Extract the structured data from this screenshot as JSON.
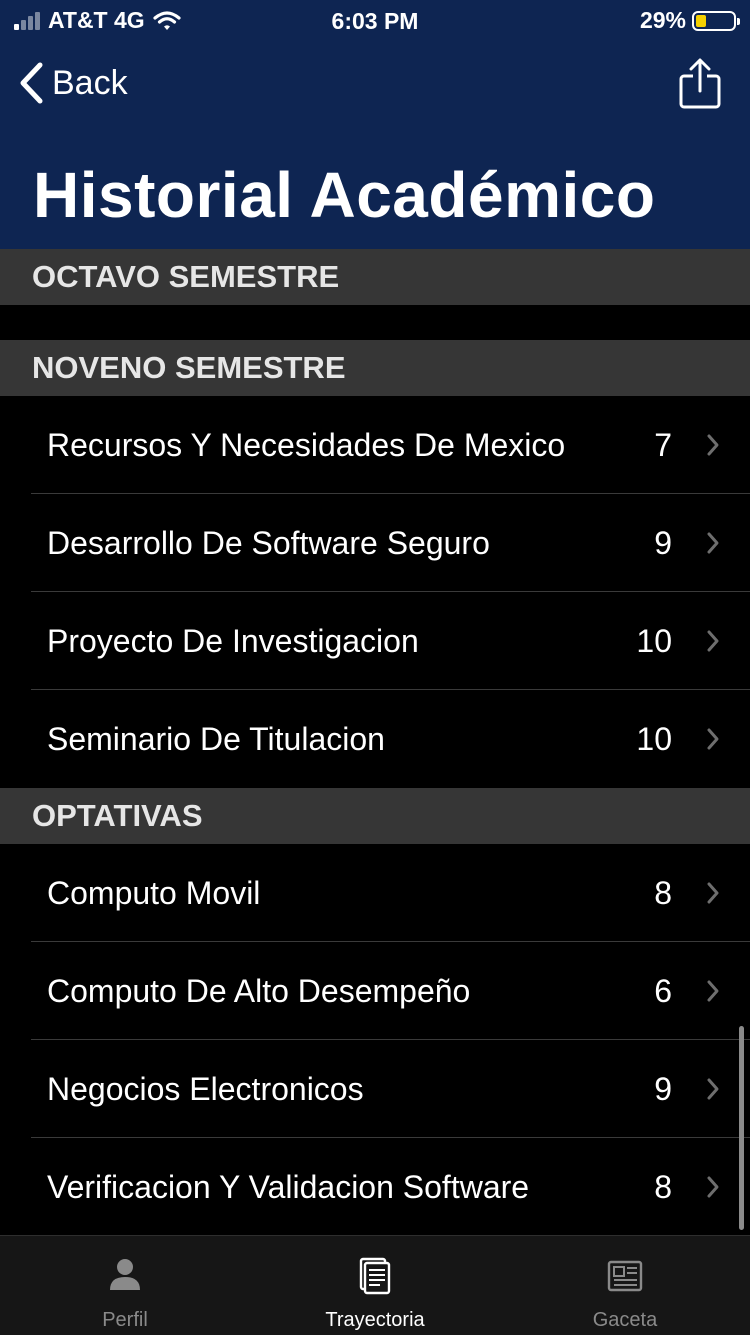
{
  "status_bar": {
    "carrier": "AT&T 4G",
    "time": "6:03 PM",
    "battery": "29%",
    "battery_level": 0.29
  },
  "nav": {
    "back_label": "Back",
    "title": "Historial Académico",
    "back_icon": "chevron-left-icon",
    "share_icon": "share-icon"
  },
  "sections": [
    {
      "title": "OCTAVO SEMESTRE",
      "rows": []
    },
    {
      "title": "NOVENO SEMESTRE",
      "rows": [
        {
          "name": "Recursos Y Necesidades De Mexico",
          "grade": "7"
        },
        {
          "name": "Desarrollo De Software Seguro",
          "grade": "9"
        },
        {
          "name": "Proyecto De Investigacion",
          "grade": "10"
        },
        {
          "name": "Seminario De Titulacion",
          "grade": "10"
        }
      ]
    },
    {
      "title": "OPTATIVAS",
      "rows": [
        {
          "name": "Computo Movil",
          "grade": "8"
        },
        {
          "name": "Computo De Alto Desempeño",
          "grade": "6"
        },
        {
          "name": "Negocios Electronicos",
          "grade": "9"
        },
        {
          "name": "Verificacion Y Validacion Software",
          "grade": "8"
        }
      ]
    }
  ],
  "tabs": [
    {
      "label": "Perfil",
      "icon": "person-icon",
      "active": false
    },
    {
      "label": "Trayectoria",
      "icon": "document-icon",
      "active": true
    },
    {
      "label": "Gaceta",
      "icon": "newspaper-icon",
      "active": false
    }
  ],
  "colors": {
    "header_bg": "#0e2552",
    "section_bg": "#363636",
    "tab_active": "#ffffff",
    "tab_inactive": "#8a8a8a"
  }
}
